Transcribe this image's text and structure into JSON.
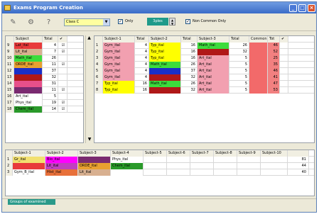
{
  "window": {
    "title": "Exams Program Creation"
  },
  "toolbar": {
    "class_select": "Class C",
    "only_label": "Only",
    "only_checked": true,
    "spin_value": "3ples",
    "non_common_label": "Non Common Only",
    "non_common_checked": true
  },
  "left_grid": {
    "headers": [
      "",
      "Subject",
      "Total",
      "✔"
    ],
    "rows": [
      {
        "n": "9",
        "subject": "Lat_ital",
        "total": "4",
        "checked": true,
        "color": "#e83a3a"
      },
      {
        "n": "9",
        "subject": "Lit_ital",
        "total": "7",
        "checked": true,
        "color": "#d8b090"
      },
      {
        "n": "10",
        "subject": "Math_ital",
        "total": "26",
        "checked": false,
        "color": "#3cdc3c"
      },
      {
        "n": "11",
        "subject": "ORDE_ital",
        "total": "11",
        "checked": true,
        "color": "#e8a030"
      },
      {
        "n": "12",
        "subject": "",
        "total": "37",
        "checked": false,
        "color": "#1a2fc8"
      },
      {
        "n": "13",
        "subject": "",
        "total": "32",
        "checked": false,
        "color": "#b01818"
      },
      {
        "n": "14",
        "subject": "",
        "total": "31",
        "checked": false,
        "color": "#e8508a"
      },
      {
        "n": "15",
        "subject": "",
        "total": "11",
        "checked": true,
        "color": "#7a2a70"
      },
      {
        "n": "16",
        "subject": "Art_ital",
        "total": "5",
        "checked": false,
        "color": "#ffffff"
      },
      {
        "n": "17",
        "subject": "Phys_ital",
        "total": "19",
        "checked": true,
        "color": "#ffffff"
      },
      {
        "n": "18",
        "subject": "Chem_ital",
        "total": "14",
        "checked": true,
        "color": "#2a9a2a"
      }
    ]
  },
  "main_grid": {
    "headers": [
      "",
      "Subject-1",
      "Total",
      "Subject-2",
      "Total",
      "Subject-3",
      "Total",
      "Common",
      "Tot",
      "✔"
    ],
    "rows": [
      {
        "n": "1",
        "s1": "Gym_ital",
        "t1": "4",
        "c1": "#f2a0b0",
        "s2": "Typ_ital",
        "t2": "16",
        "c2": "#ffff00",
        "s3": "Math_ital",
        "t3": "26",
        "c3": "#3cdc3c",
        "common": "",
        "tot": "46"
      },
      {
        "n": "2",
        "s1": "Gym_ital",
        "t1": "4",
        "c1": "#f2a0b0",
        "s2": "Typ_ital",
        "t2": "16",
        "c2": "#ffff00",
        "s3": "",
        "t3": "32",
        "c3": "#b01818",
        "common": "",
        "tot": "52"
      },
      {
        "n": "3",
        "s1": "Gym_ital",
        "t1": "4",
        "c1": "#f2a0b0",
        "s2": "Typ_ital",
        "t2": "16",
        "c2": "#ffff00",
        "s3": "Art_ital",
        "t3": "5",
        "c3": "#f2a0b0",
        "common": "",
        "tot": "25"
      },
      {
        "n": "4",
        "s1": "Gym_ital",
        "t1": "4",
        "c1": "#f2a0b0",
        "s2": "Math_ital",
        "t2": "26",
        "c2": "#3cdc3c",
        "s3": "Art_ital",
        "t3": "5",
        "c3": "#f2a0b0",
        "common": "",
        "tot": "35"
      },
      {
        "n": "5",
        "s1": "Gym_ital",
        "t1": "4",
        "c1": "#f2a0b0",
        "s2": "",
        "t2": "37",
        "c2": "#1a2fc8",
        "s3": "Art_ital",
        "t3": "5",
        "c3": "#f2a0b0",
        "common": "",
        "tot": "46"
      },
      {
        "n": "6",
        "s1": "Gym_ital",
        "t1": "4",
        "c1": "#f2a0b0",
        "s2": "",
        "t2": "32",
        "c2": "#b01818",
        "s3": "Art_ital",
        "t3": "5",
        "c3": "#f2a0b0",
        "common": "",
        "tot": "41"
      },
      {
        "n": "7",
        "s1": "Typ_ital",
        "t1": "16",
        "c1": "#ffff00",
        "s2": "Math_ital",
        "t2": "26",
        "c2": "#3cdc3c",
        "s3": "Art_ital",
        "t3": "5",
        "c3": "#f2a0b0",
        "common": "",
        "tot": "47"
      },
      {
        "n": "8",
        "s1": "Typ_ital",
        "t1": "16",
        "c1": "#ffff00",
        "s2": "",
        "t2": "32",
        "c2": "#b01818",
        "s3": "Art_ital",
        "t3": "5",
        "c3": "#f2a0b0",
        "common": "",
        "tot": "53"
      }
    ]
  },
  "bottom_grid": {
    "headers": [
      "",
      "Subject-1",
      "Subject-2",
      "Subject-3",
      "Subject-4",
      "Subject-5",
      "Subject-6",
      "Subject-7",
      "Subject-8",
      "Subject-9",
      "Subject-10",
      ""
    ],
    "rows": [
      {
        "n": "1",
        "cells": [
          {
            "t": "Gr_ital",
            "c": "#f2e070"
          },
          {
            "t": "Bio_ital",
            "c": "#ff00ff"
          },
          {
            "t": "",
            "c": "#7a2a70"
          },
          {
            "t": "Phys_ital",
            "c": "#ffffff"
          }
        ],
        "total": "81"
      },
      {
        "n": "2",
        "cells": [
          {
            "t": "",
            "c": "#e83a3a"
          },
          {
            "t": "Lit_ital",
            "c": "#c040c0"
          },
          {
            "t": "ORDE_ital",
            "c": "#e8a030"
          },
          {
            "t": "Chem_ital",
            "c": "#2a9a2a"
          }
        ],
        "total": "44"
      },
      {
        "n": "3",
        "cells": [
          {
            "t": "Gym_B_ital",
            "c": "#ffffff"
          },
          {
            "t": "Hist_ital",
            "c": "#e8703a"
          },
          {
            "t": "Lit_ital",
            "c": "#d8b090"
          },
          {
            "t": "",
            "c": "#ffffff"
          }
        ],
        "total": "40"
      }
    ]
  },
  "status": {
    "tab_label": "Groups of examined"
  },
  "colors": {
    "common_col": "#f26a6a",
    "tot_col": "#f28080",
    "title_bar": "#3a6bc7"
  }
}
